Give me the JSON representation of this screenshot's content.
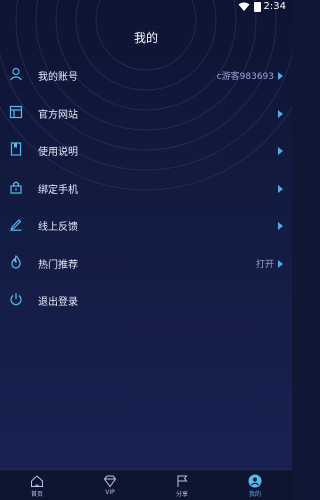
{
  "status_bar": {
    "time": "2:34",
    "icons": [
      "wifi-icon",
      "battery-icon"
    ]
  },
  "header": {
    "title": "我的"
  },
  "menu": [
    {
      "label": "我的账号",
      "value": "c游客983693",
      "icon": "user-icon",
      "has_arrow": true
    },
    {
      "label": "官方网站",
      "value": "",
      "icon": "website-icon",
      "has_arrow": true
    },
    {
      "label": "使用说明",
      "value": "",
      "icon": "book-icon",
      "has_arrow": true
    },
    {
      "label": "绑定手机",
      "value": "",
      "icon": "lock-icon",
      "has_arrow": true
    },
    {
      "label": "线上反馈",
      "value": "",
      "icon": "pencil-icon",
      "has_arrow": true
    },
    {
      "label": "热门推荐",
      "value": "打开",
      "icon": "flame-icon",
      "has_arrow": true
    },
    {
      "label": "退出登录",
      "value": "",
      "icon": "power-icon",
      "has_arrow": false
    }
  ],
  "tabs": [
    {
      "label": "首页",
      "icon": "home-icon",
      "active": false
    },
    {
      "label": "VIP",
      "icon": "diamond-icon",
      "active": false
    },
    {
      "label": "分享",
      "icon": "flag-icon",
      "active": false
    },
    {
      "label": "我的",
      "icon": "profile-icon",
      "active": true
    }
  ],
  "colors": {
    "background": "#141d45",
    "accent": "#57b9f1",
    "arrow": "#54a8e6",
    "text": "#e8ecff",
    "muted": "#9aa6d8"
  }
}
